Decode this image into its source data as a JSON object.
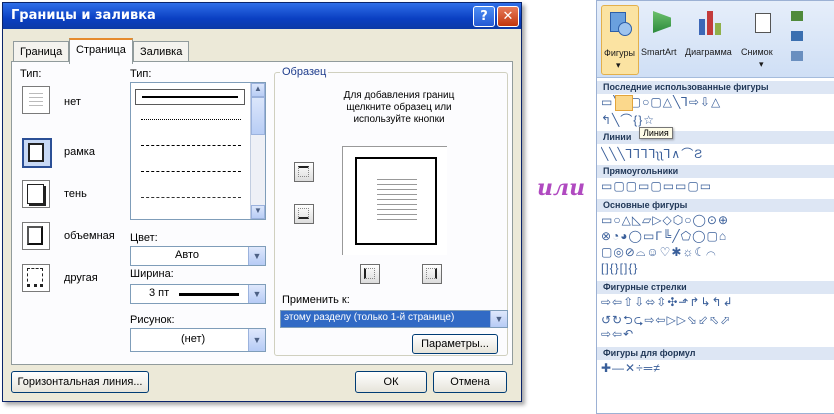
{
  "dialog": {
    "title": "Границы и заливка",
    "help_glyph": "?",
    "close_glyph": "✕",
    "tabs": [
      "Граница",
      "Страница",
      "Заливка"
    ],
    "type_label": "Тип:",
    "type_options": [
      "нет",
      "рамка",
      "тень",
      "объемная",
      "другая"
    ],
    "line_type_label": "Тип:",
    "color_label": "Цвет:",
    "color_value": "Авто",
    "width_label": "Ширина:",
    "width_value": "3 пт",
    "art_label": "Рисунок:",
    "art_value": "(нет)",
    "preview_label": "Образец",
    "preview_hint": "Для добавления границ щелкните образец или используйте кнопки",
    "apply_label": "Применить к:",
    "apply_value": "этому разделу (только 1-й странице)",
    "params_button": "Параметры...",
    "horiz_line_button": "Горизонтальная линия...",
    "ok_button": "ОК",
    "cancel_button": "Отмена"
  },
  "separator": "или",
  "ribbon": {
    "buttons": [
      "Фигуры",
      "SmartArt",
      "Диаграмма",
      "Снимок"
    ],
    "sections": [
      "Последние использованные фигуры",
      "Линии",
      "Прямоугольники",
      "Основные фигуры",
      "Фигурные стрелки",
      "Фигуры для формул"
    ],
    "tooltip": "Линия",
    "shape_rows": {
      "recent": "▭╲╲▢○▢△╲⅂⇨⇩△",
      "recent2": "↰╲⌒{}☆",
      "lines": "╲╲╲⅂⅂⅂⅂ʅʅ⅂∧⌒Ƨ",
      "rects": "▭▢▢▭▢▭▭▢▭",
      "basic1": "▭○△◺▱▷◇⬡○◯⊙⊕",
      "basic2": "⊗◔◕◯▭Γ╚╱⬠◯▢⌂",
      "basic3": "▢◎⊘⌓☺♡✱☼☾⌒",
      "basic4": "[]{}[]{}",
      "arrows1": "⇨⇦⇧⇩⬄⇳✣⬏↱↳↰↲",
      "arrows2": "↺↻⮌⮎⇨⇦▷▷⬂⬃⬁⬀",
      "arrows3": "⇨⇦↶",
      "formula": "✚—✕÷═≠"
    }
  },
  "colors": {
    "titlebar": "#0a3fc2",
    "panel": "#fcfcfe",
    "selection": "#316ac5",
    "separator": "#b04ac0"
  }
}
